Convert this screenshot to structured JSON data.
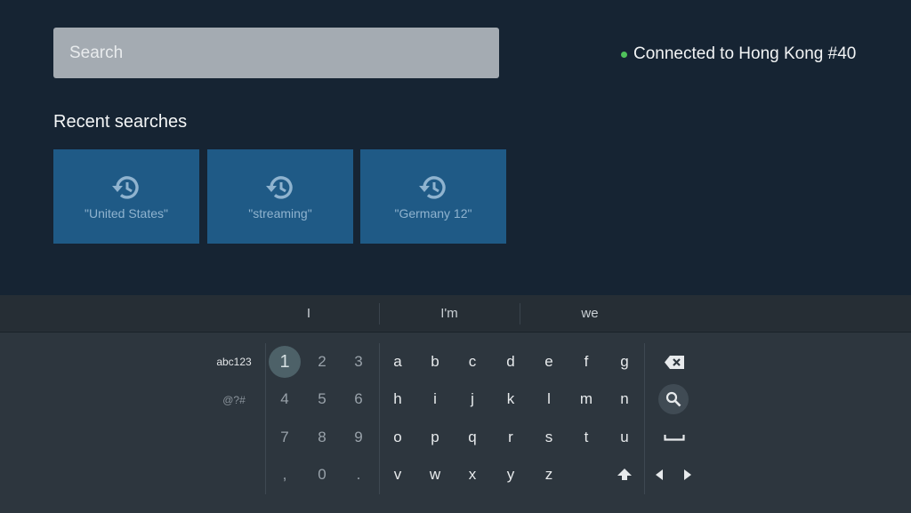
{
  "search": {
    "placeholder": "Search"
  },
  "status": {
    "text": "Connected to Hong Kong #40",
    "color": "#4fc25b"
  },
  "recent": {
    "title": "Recent searches",
    "items": [
      {
        "label": "\"United States\"",
        "icon": "history-icon"
      },
      {
        "label": "\"streaming\"",
        "icon": "history-icon"
      },
      {
        "label": "\"Germany 12\"",
        "icon": "history-icon"
      }
    ]
  },
  "keyboard": {
    "suggestions": [
      "I",
      "I'm",
      "we"
    ],
    "modes": {
      "primary": "abc123",
      "symbols": "@?#"
    },
    "numbers": [
      "1",
      "2",
      "3",
      "4",
      "5",
      "6",
      "7",
      "8",
      "9",
      ",",
      "0",
      "."
    ],
    "letters": [
      "a",
      "b",
      "c",
      "d",
      "e",
      "f",
      "g",
      "h",
      "i",
      "j",
      "k",
      "l",
      "m",
      "n",
      "o",
      "p",
      "q",
      "r",
      "s",
      "t",
      "u",
      "v",
      "w",
      "x",
      "y",
      "z"
    ],
    "selected_key": "1",
    "actions": [
      "backspace-icon",
      "search-icon",
      "space-icon",
      "shift-icon",
      "arrow-left-icon",
      "arrow-right-icon"
    ]
  },
  "colors": {
    "background": "#162433",
    "tile": "#1f5a86",
    "keyboard": "#2d363e"
  }
}
